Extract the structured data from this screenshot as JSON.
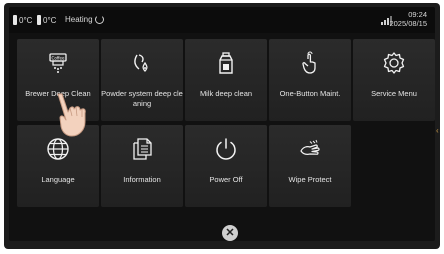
{
  "status": {
    "temp1": "0°C",
    "temp2": "0°C",
    "heating": "Heating",
    "time": "09:24",
    "date": "2025/08/15"
  },
  "menu": {
    "tiles": [
      {
        "label": "Brewer Deep Clean",
        "icon": "brewer-icon"
      },
      {
        "label": "Powder system deep cle aning",
        "icon": "powder-drop-icon"
      },
      {
        "label": "Milk deep clean",
        "icon": "milk-carton-icon"
      },
      {
        "label": "One-Button Maint.",
        "icon": "tap-hand-icon"
      },
      {
        "label": "Service Menu",
        "icon": "gear-icon"
      },
      {
        "label": "Language",
        "icon": "globe-icon"
      },
      {
        "label": "Information",
        "icon": "documents-icon"
      },
      {
        "label": "Power Off",
        "icon": "power-icon"
      },
      {
        "label": "Wipe Protect",
        "icon": "wipe-hand-icon"
      }
    ]
  },
  "close": {
    "icon": "close-icon"
  },
  "colors": {
    "background": "#111111",
    "tile": "#262626",
    "text": "#e4e4e4",
    "accent": "#c99a4a"
  }
}
